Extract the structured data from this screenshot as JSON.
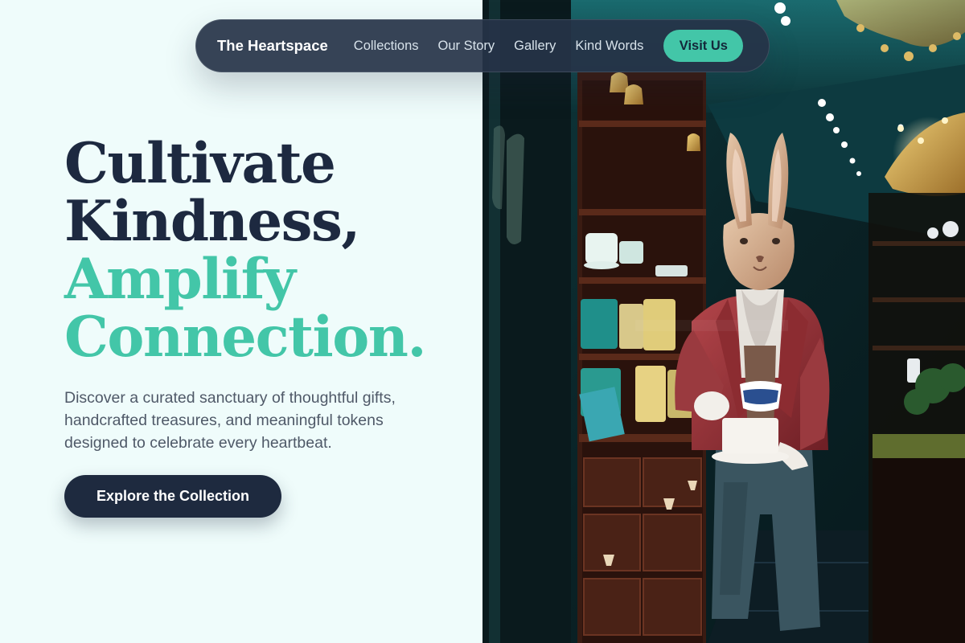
{
  "nav": {
    "brand": "The Heartspace",
    "links": [
      "Collections",
      "Our Story",
      "Gallery",
      "Kind Words"
    ],
    "cta": "Visit Us"
  },
  "hero": {
    "headline": [
      "Cultivate",
      "Kindness,",
      "Amplify",
      "Connection."
    ],
    "subtext": "Discover a curated sanctuary of thoughtful gifts, handcrafted treasures, and meaningful tokens designed to celebrate every heartbeat.",
    "cta": "Explore the Collection"
  },
  "colors": {
    "background": "#effcfb",
    "navy": "#1d2940",
    "accent": "#43c6a8",
    "body_text": "#4f5968"
  },
  "image": {
    "name": "shop-interior-photo"
  }
}
